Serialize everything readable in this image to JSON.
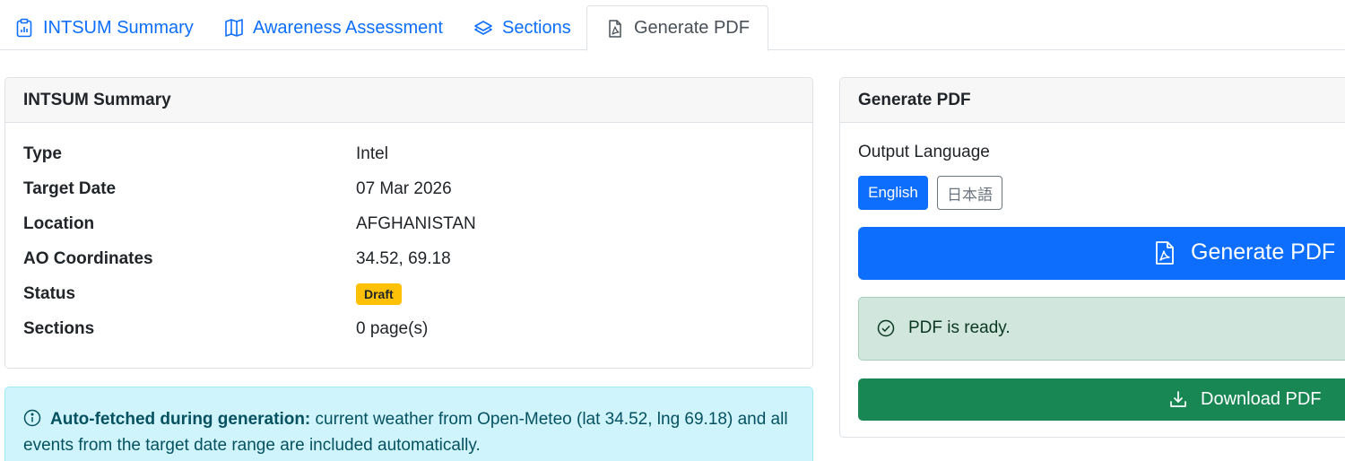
{
  "tabs": [
    {
      "label": "INTSUM Summary",
      "icon": "clipboard-chart-icon",
      "active": false
    },
    {
      "label": "Awareness Assessment",
      "icon": "map-icon",
      "active": false
    },
    {
      "label": "Sections",
      "icon": "layers-icon",
      "active": false
    },
    {
      "label": "Generate PDF",
      "icon": "file-pdf-icon",
      "active": true
    }
  ],
  "summary": {
    "title": "INTSUM Summary",
    "rows": [
      {
        "label": "Type",
        "value": "Intel"
      },
      {
        "label": "Target Date",
        "value": "07 Mar 2026"
      },
      {
        "label": "Location",
        "value": "AFGHANISTAN"
      },
      {
        "label": "AO Coordinates",
        "value": "34.52, 69.18"
      },
      {
        "label": "Status",
        "value": "Draft"
      },
      {
        "label": "Sections",
        "value": "0 page(s)"
      }
    ]
  },
  "info_alert": {
    "bold": "Auto-fetched during generation:",
    "text": " current weather from Open-Meteo (lat 34.52, lng 69.18) and all events from the target date range are included automatically."
  },
  "generate": {
    "title": "Generate PDF",
    "output_language_label": "Output Language",
    "languages": [
      {
        "label": "English",
        "selected": true
      },
      {
        "label": "日本語",
        "selected": false
      }
    ],
    "generate_button": "Generate PDF",
    "ready_message": "PDF is ready.",
    "download_button": "Download PDF"
  },
  "colors": {
    "primary": "#0d6efd",
    "success": "#198754",
    "warning": "#ffc107",
    "info_bg": "#cff4fc",
    "success_bg": "#d1e7dd"
  }
}
